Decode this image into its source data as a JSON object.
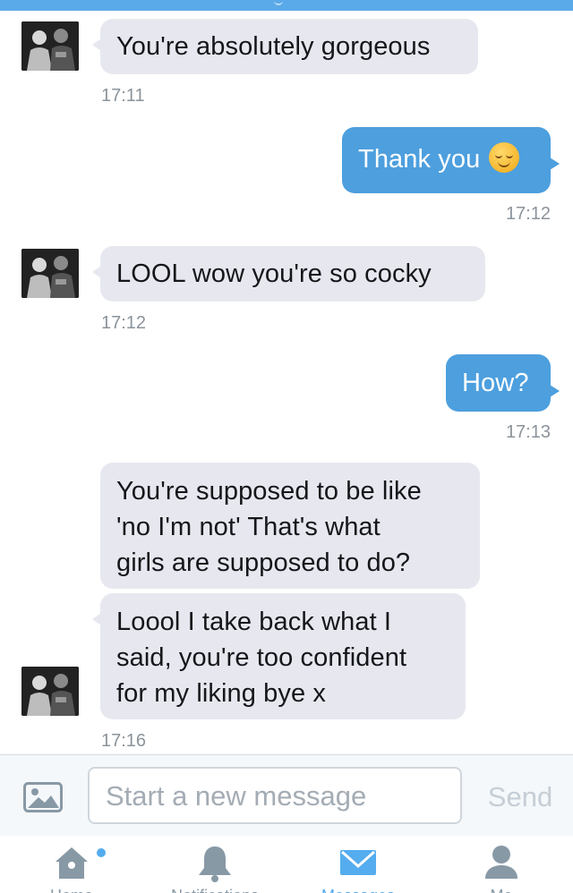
{
  "conversation": {
    "messages": [
      {
        "id": "m1",
        "from": "them",
        "text": "You're absolutely gorgeous",
        "time": "17:11"
      },
      {
        "id": "m2",
        "from": "me",
        "text": "Thank you",
        "emoji": "relieved-face",
        "time": "17:12"
      },
      {
        "id": "m3",
        "from": "them",
        "text": "LOOL wow you're so cocky",
        "time": "17:12"
      },
      {
        "id": "m4",
        "from": "me",
        "text": "How?",
        "time": "17:13"
      },
      {
        "id": "m5",
        "from": "them",
        "lines": [
          "You're supposed to be like",
          "'no I'm not' That's what",
          "girls are supposed to do?"
        ]
      },
      {
        "id": "m6",
        "from": "them",
        "lines": [
          "Loool I take back what I",
          "said, you're too confident",
          "for my liking bye x"
        ],
        "time": "17:16"
      }
    ]
  },
  "composer": {
    "placeholder": "Start a new message",
    "send_label": "Send",
    "photo_icon": "image-icon"
  },
  "tabbar": {
    "tabs": [
      {
        "icon": "home-icon",
        "label": "Home",
        "has_notification_dot": true
      },
      {
        "icon": "bell-icon",
        "label": "Notifications"
      },
      {
        "icon": "envelope-icon",
        "label": "Messages",
        "active": true
      },
      {
        "icon": "person-icon",
        "label": "Me"
      }
    ]
  },
  "colors": {
    "accent": "#55acee",
    "outgoing_bubble": "#4d9fde",
    "incoming_bubble": "#e7e8ef",
    "timestamp": "#8b939b"
  }
}
